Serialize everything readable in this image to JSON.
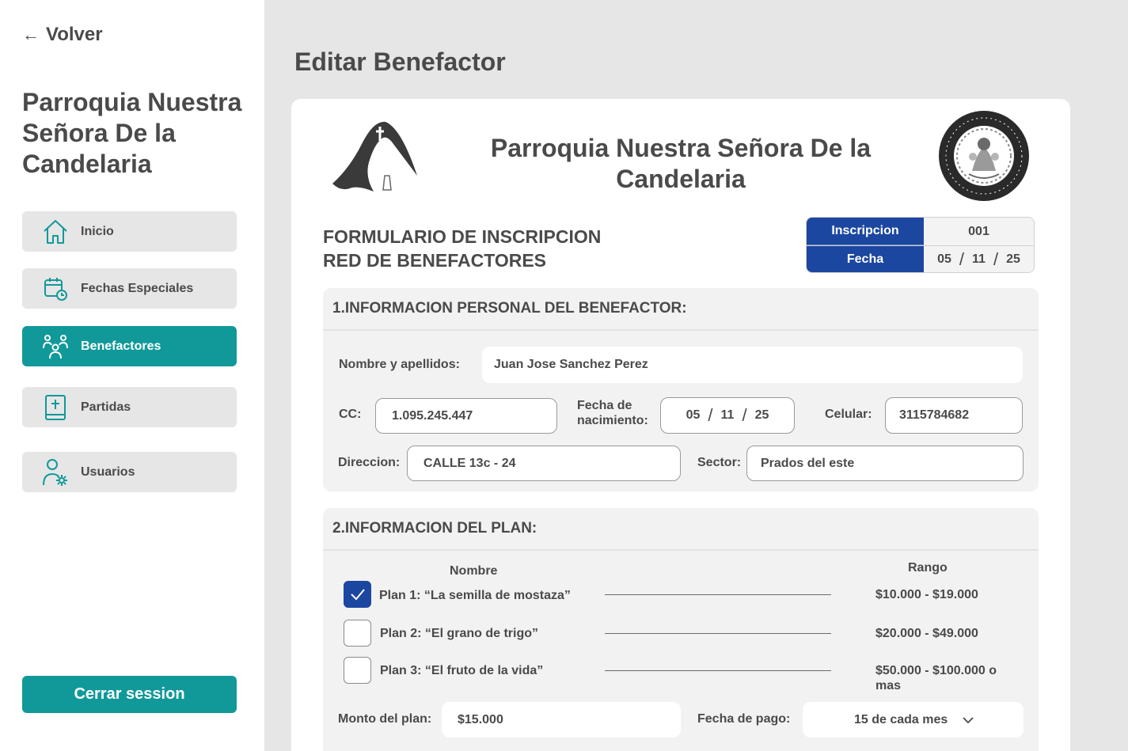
{
  "sidebar": {
    "back_label": "Volver",
    "title": "Parroquia Nuestra Señora De la Candelaria",
    "nav": [
      {
        "label": "Inicio",
        "icon": "home-icon"
      },
      {
        "label": "Fechas Especiales",
        "icon": "calendar-clock-icon"
      },
      {
        "label": "Benefactores",
        "icon": "users-icon",
        "active": true
      },
      {
        "label": "Partidas",
        "icon": "book-icon"
      },
      {
        "label": "Usuarios",
        "icon": "user-settings-icon"
      }
    ],
    "logout_label": "Cerrar session"
  },
  "main": {
    "page_title": "Editar Benefactor",
    "parish_title": "Parroquia Nuestra Señora De la Candelaria",
    "form_title_line1": "FORMULARIO DE INSCRIPCION",
    "form_title_line2": "RED DE BENEFACTORES",
    "registration": {
      "inscripcion_label": "Inscripcion",
      "inscripcion_value": "001",
      "fecha_label": "Fecha",
      "fecha_day": "05",
      "fecha_month": "11",
      "fecha_year": "25"
    }
  },
  "personal": {
    "heading": "1.INFORMACION PERSONAL DEL BENEFACTOR:",
    "name_label": "Nombre y apellidos:",
    "name_value": "Juan Jose Sanchez Perez",
    "cc_label": "CC:",
    "cc_value": "1.095.245.447",
    "birth_label_1": "Fecha de",
    "birth_label_2": "nacimiento:",
    "birth_day": "05",
    "birth_month": "11",
    "birth_year": "25",
    "phone_label": "Celular:",
    "phone_value": "3115784682",
    "address_label": "Direccion:",
    "address_value": "CALLE 13c - 24",
    "sector_label": "Sector:",
    "sector_value": "Prados del este"
  },
  "plan": {
    "heading": "2.INFORMACION DEL PLAN:",
    "col_name": "Nombre",
    "col_range": "Rango",
    "plans": [
      {
        "name": "Plan 1: “La semilla de mostaza”",
        "range": "$10.000 - $19.000",
        "checked": true
      },
      {
        "name": "Plan 2: “El grano de trigo”",
        "range": "$20.000 - $49.000",
        "checked": false
      },
      {
        "name": "Plan 3: “El fruto de la vida”",
        "range": "$50.000 - $100.000 o mas",
        "checked": false
      }
    ],
    "amount_label": "Monto del plan:",
    "amount_value": "$15.000",
    "payment_label": "Fecha de pago:",
    "payment_value": "15 de cada mes"
  },
  "colors": {
    "accent_teal": "#11999a",
    "accent_blue": "#1c47a0",
    "text": "#4a4a4a",
    "background": "#e6e6e6"
  }
}
